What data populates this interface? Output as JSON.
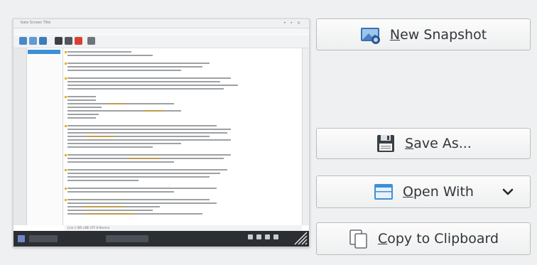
{
  "preview": {
    "mini_window_title": "Kate Screen Title",
    "mini_menu": [
      "File",
      "Edit",
      "View",
      "Projects",
      "Bookmarks",
      "Sessions",
      "Tools",
      "Settings",
      "Help"
    ],
    "mini_status_text": "Line 1  INS  LINE  UTF-8  Normal"
  },
  "buttons": {
    "new_snapshot": {
      "mnemonic": "N",
      "rest": "ew Snapshot",
      "icon": "camera-icon"
    },
    "save_as": {
      "mnemonic": "S",
      "rest": "ave As...",
      "icon": "floppy-disk-icon"
    },
    "open_with": {
      "mnemonic": "O",
      "rest": "pen With",
      "icon": "window-icon",
      "dropdown_icon": "chevron-down-icon"
    },
    "copy_to_clipboard": {
      "mnemonic": "C",
      "rest": "opy to Clipboard",
      "icon": "clipboard-copy-icon"
    }
  },
  "colors": {
    "background": "#eff0f1",
    "text": "#31363b",
    "accent": "#3d8fd6"
  }
}
